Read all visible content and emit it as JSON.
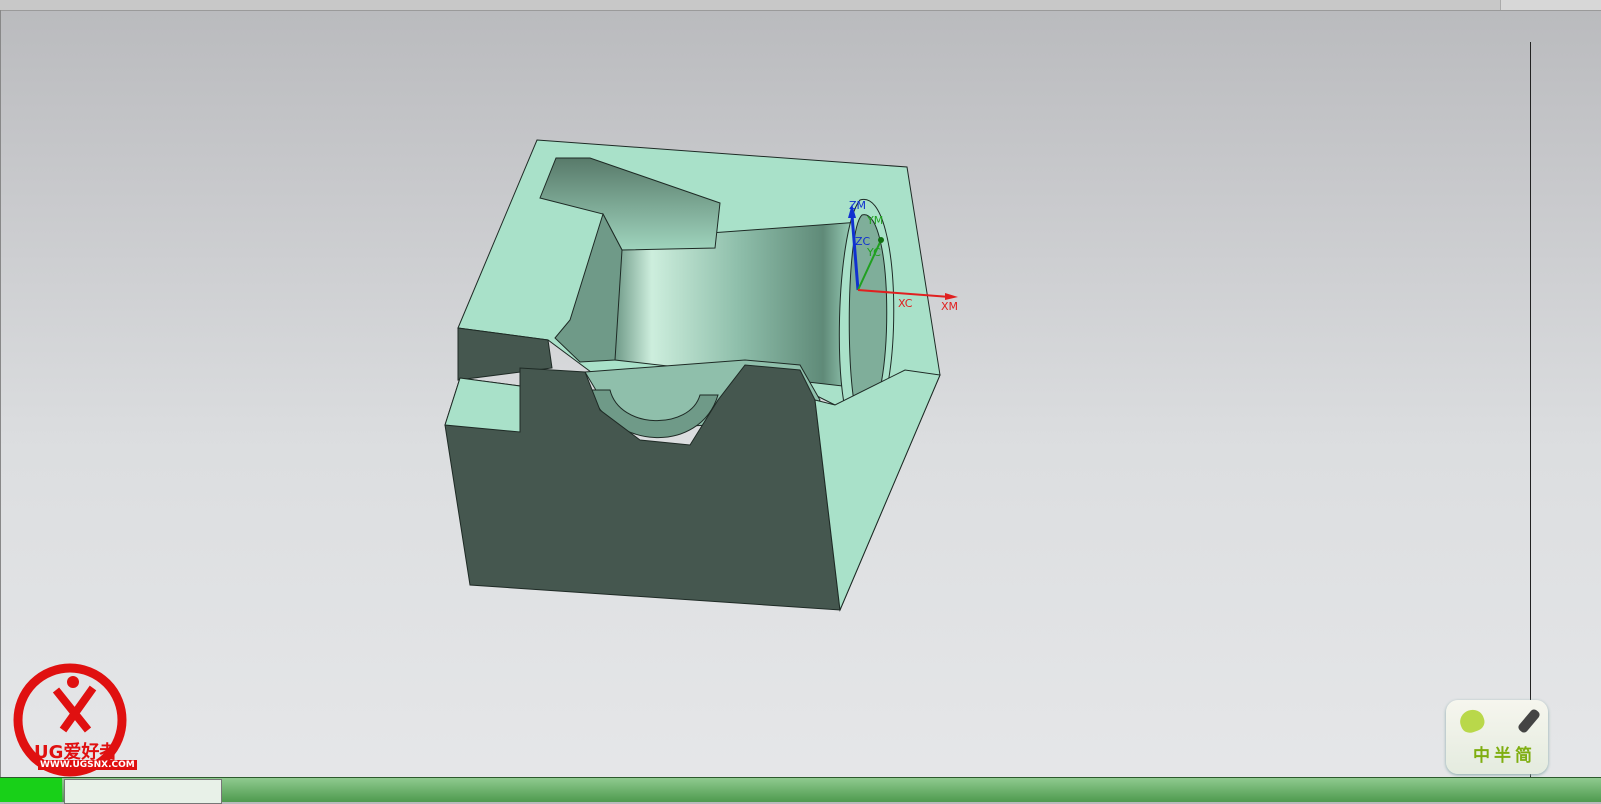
{
  "viewport": {
    "background_top": "#b9babd",
    "background_bottom": "#e6e7e9",
    "model_colors": {
      "light_face": "#a9e1c9",
      "dark_face": "#45574f",
      "edge": "#1e2a25"
    },
    "triad": {
      "zm": "ZM",
      "ym": "YM",
      "zc": "ZC",
      "yc": "YC",
      "xc": "XC",
      "xm": "XM",
      "colors": {
        "z": "#1030d0",
        "y": "#20a020",
        "x": "#e02020"
      }
    }
  },
  "watermark": {
    "name": "UG爱好者",
    "url": "WWW.UGSNX.COM"
  },
  "ime_widget": {
    "label": "中半简"
  }
}
